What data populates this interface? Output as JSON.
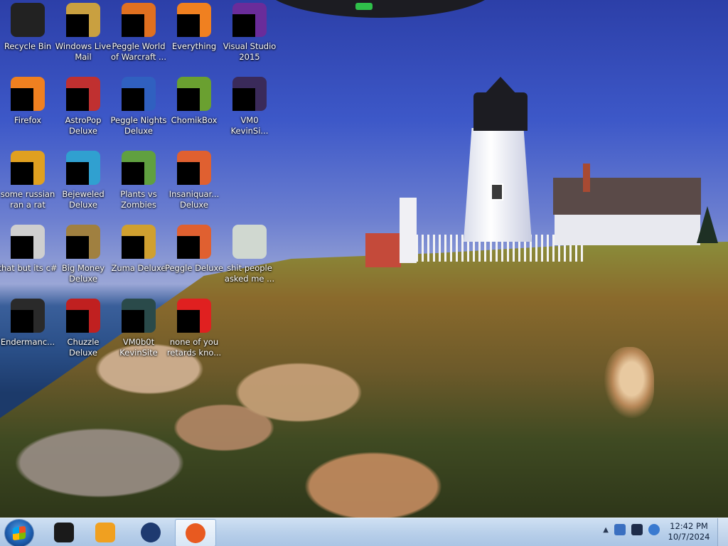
{
  "desktop": {
    "icons": [
      {
        "name": "Recycle Bin",
        "label": "Recycle Bin",
        "masked": false,
        "color": "#222"
      },
      {
        "name": "Windows Live Mail",
        "label": "Windows Live\nMail",
        "masked": true,
        "color": "#c9a040"
      },
      {
        "name": "Peggle World of Warcraft",
        "label": "Peggle World\nof Warcraft ...",
        "masked": true,
        "color": "#e07020"
      },
      {
        "name": "Everything",
        "label": "Everything",
        "masked": true,
        "color": "#f08020"
      },
      {
        "name": "Visual Studio 2015",
        "label": "Visual Studio\n2015",
        "masked": true,
        "color": "#6a2c9a"
      },
      {
        "name": "Firefox",
        "label": "Firefox",
        "masked": true,
        "color": "#f08020"
      },
      {
        "name": "AstroPop Deluxe",
        "label": "AstroPop\nDeluxe",
        "masked": true,
        "color": "#c03030"
      },
      {
        "name": "Peggle Nights Deluxe",
        "label": "Peggle Nights\nDeluxe",
        "masked": true,
        "color": "#3060c0"
      },
      {
        "name": "ChomikBox",
        "label": "ChomikBox",
        "masked": true,
        "color": "#6aa030"
      },
      {
        "name": "VM0 KevinSi...",
        "label": "VM0\nKevinSi...",
        "masked": true,
        "color": "#3a2a5a"
      },
      {
        "name": "some russian ran a rat",
        "label": "some russian\nran a rat",
        "masked": true,
        "color": "#e0a020"
      },
      {
        "name": "Bejeweled Deluxe",
        "label": "Bejeweled\nDeluxe",
        "masked": true,
        "color": "#30a0d0"
      },
      {
        "name": "Plants vs Zombies",
        "label": "Plants vs\nZombies",
        "masked": true,
        "color": "#60a040"
      },
      {
        "name": "Insaniquarium Deluxe",
        "label": "Insaniquar...\nDeluxe",
        "masked": true,
        "color": "#e06030"
      },
      {
        "name": "that but its c#",
        "label": "that but its c#",
        "masked": true,
        "color": "#cfcfcf"
      },
      {
        "name": "Big Money Deluxe",
        "label": "Big Money\nDeluxe",
        "masked": true,
        "color": "#a08040"
      },
      {
        "name": "Zuma Deluxe",
        "label": "Zuma Deluxe",
        "masked": true,
        "color": "#d0a030"
      },
      {
        "name": "Peggle Deluxe",
        "label": "Peggle Deluxe",
        "masked": true,
        "color": "#e06030"
      },
      {
        "name": "shit people asked me ...",
        "label": "shit people\nasked me ...",
        "masked": false,
        "color": "#d0d8d0"
      },
      {
        "name": "Endermancer",
        "label": "Endermanc...",
        "masked": true,
        "color": "#2a2a2a"
      },
      {
        "name": "Chuzzle Deluxe",
        "label": "Chuzzle\nDeluxe",
        "masked": true,
        "color": "#c02020"
      },
      {
        "name": "VM0b0t KevinSite",
        "label": "VM0b0t\nKevinSite",
        "masked": true,
        "color": "#2a4a4a"
      },
      {
        "name": "none of you retards kno...",
        "label": "none of you\nretards kno...",
        "masked": true,
        "color": "#e02020"
      }
    ]
  },
  "taskbar": {
    "start_icon": "windows-logo-icon",
    "pinned": [
      {
        "name": "explorer",
        "icon": "folder-icon",
        "color": "#1a1a1a",
        "active": false
      },
      {
        "name": "media-player",
        "icon": "media-player-icon",
        "color": "#f0a020",
        "active": false
      },
      {
        "name": "globe",
        "icon": "globe-icon",
        "color": "#1e3a70",
        "active": false
      },
      {
        "name": "firefox",
        "icon": "firefox-icon",
        "color": "#e85a20",
        "active": true
      }
    ],
    "tray": {
      "chevron": "▲",
      "icons": [
        "network-icon",
        "monitor-icon",
        "sync-icon"
      ]
    },
    "clock": {
      "time": "12:42 PM",
      "date": "10/7/2024"
    }
  }
}
